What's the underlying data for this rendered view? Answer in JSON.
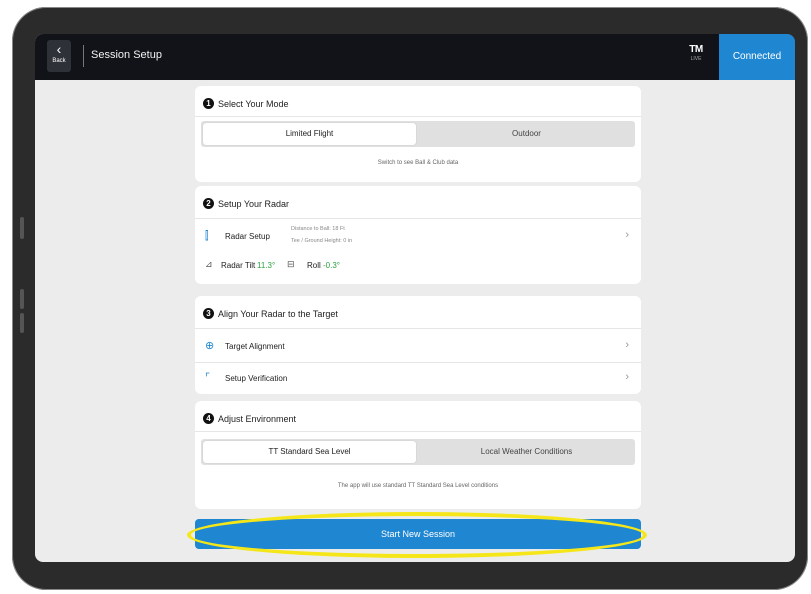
{
  "topbar": {
    "back_label": "Back",
    "title": "Session Setup",
    "logo_text": "TM",
    "logo_sub": "LIVE",
    "connected_label": "Connected"
  },
  "step1": {
    "number": "1",
    "heading": "Select Your Mode",
    "options": [
      "Limited Flight",
      "Outdoor"
    ],
    "selected": "Limited Flight",
    "note": "Switch to see Ball & Club data"
  },
  "step2": {
    "number": "2",
    "heading": "Setup Your Radar",
    "radar_setup_label": "Radar Setup",
    "radar_setup_sub1": "Distance to Ball: 18 Ft",
    "radar_setup_sub2": "Tee / Ground Height: 0 in",
    "radar_tilt_label": "Radar Tilt",
    "radar_tilt_value": "11.3°",
    "roll_label": "Roll",
    "roll_value": "-0.3°"
  },
  "step3": {
    "number": "3",
    "heading": "Align Your Radar to the Target",
    "target_alignment_label": "Target Alignment",
    "setup_verification_label": "Setup Verification"
  },
  "step4": {
    "number": "4",
    "heading": "Adjust Environment",
    "options": [
      "TT Standard Sea Level",
      "Local Weather Conditions"
    ],
    "selected": "TT Standard Sea Level",
    "note": "The app will use standard TT Standard Sea Level conditions"
  },
  "start_button_label": "Start New Session",
  "colors": {
    "accent": "#1f86d1",
    "topbar": "#111318",
    "highlight": "#f5e61a",
    "positive": "#2ea043"
  },
  "icons": {
    "back": "chevron-left-icon",
    "radar": "radar-icon",
    "tilt": "tilt-icon",
    "roll": "roll-icon",
    "target": "target-icon",
    "verification": "verification-icon",
    "chevron": "chevron-right-icon"
  }
}
